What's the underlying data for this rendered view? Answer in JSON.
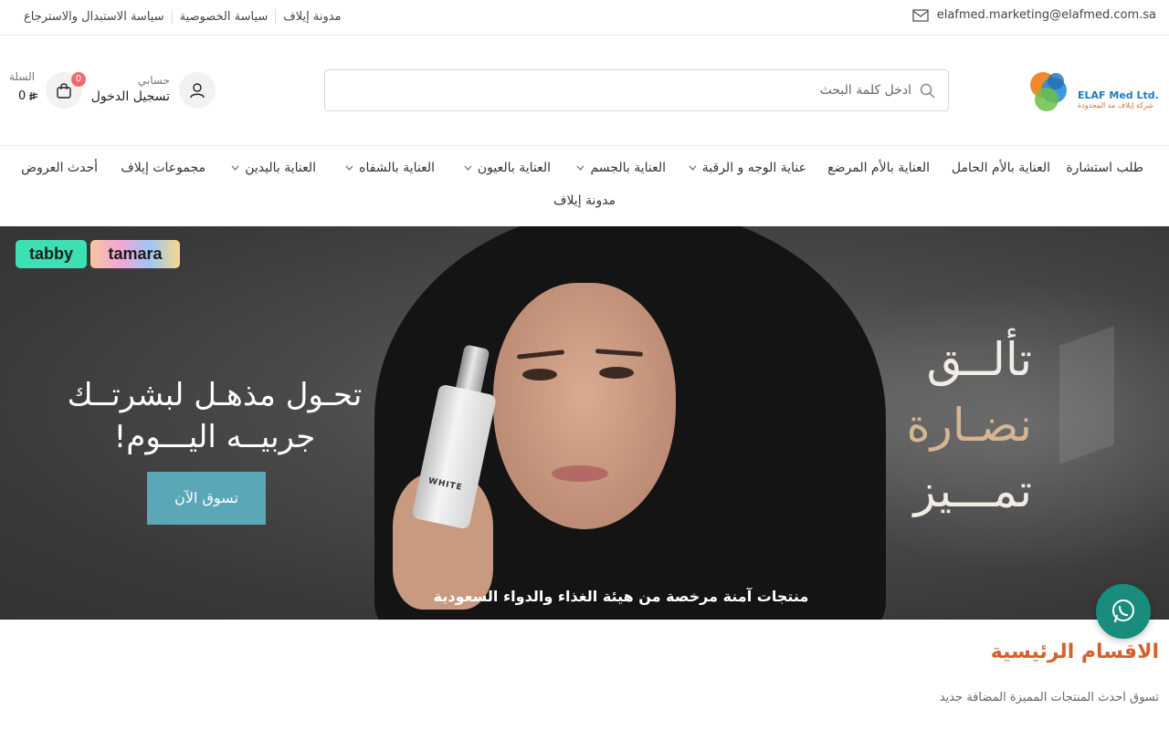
{
  "topbar": {
    "email": "elafmed.marketing@elafmed.com.sa",
    "links": [
      "مدونة إيلاف",
      "سياسة الخصوصية",
      "سياسة الاستبدال والاسترجاع"
    ]
  },
  "header": {
    "logo": {
      "name": "ELAF Med Ltd.",
      "sub": "شركة إيلاف مد المحدودة"
    },
    "search_placeholder": "ادخل كلمة البحث",
    "account": {
      "label": "حسابي",
      "login": "تسجيل الدخول"
    },
    "cart": {
      "label": "السلة",
      "count": "0",
      "total": "0"
    }
  },
  "nav": {
    "items": [
      {
        "label": "طلب استشارة",
        "dropdown": false
      },
      {
        "label": "العناية بالأم الحامل",
        "dropdown": false
      },
      {
        "label": "العناية بالأم المرضع",
        "dropdown": false
      },
      {
        "label": "عناية الوجه و الرقبة",
        "dropdown": true
      },
      {
        "label": "العناية بالجسم",
        "dropdown": true
      },
      {
        "label": "العناية بالعيون",
        "dropdown": true
      },
      {
        "label": "العناية بالشفاه",
        "dropdown": true
      },
      {
        "label": "العناية باليدين",
        "dropdown": true
      },
      {
        "label": "مجموعات إيلاف",
        "dropdown": false
      },
      {
        "label": "أحدث العروض",
        "dropdown": false
      }
    ],
    "second_row": "مدونة إيلاف"
  },
  "banner": {
    "payments": [
      "tabby",
      "tamara"
    ],
    "hero_line1": "تحـول مذهـل لبشرتــك",
    "hero_line2": "جربيــه اليـــوم!",
    "cta": "تسوق الآن",
    "tagline": [
      "تألــق",
      "نضـارة",
      "تمـــيز"
    ],
    "product_label": "WHITE",
    "footnote": "منتجات آمنة مرخصة من هيئة الغذاء والدواء السعودية"
  },
  "sections": {
    "title": "الاقسام الرئيسية",
    "subtitle": "تسوق احدث المنتجات المميزة المضافة جديد"
  },
  "colors": {
    "accent": "#d4622c",
    "cta": "#5aa8b7",
    "whatsapp": "#1a8c7d",
    "badge": "#f16b6b"
  }
}
